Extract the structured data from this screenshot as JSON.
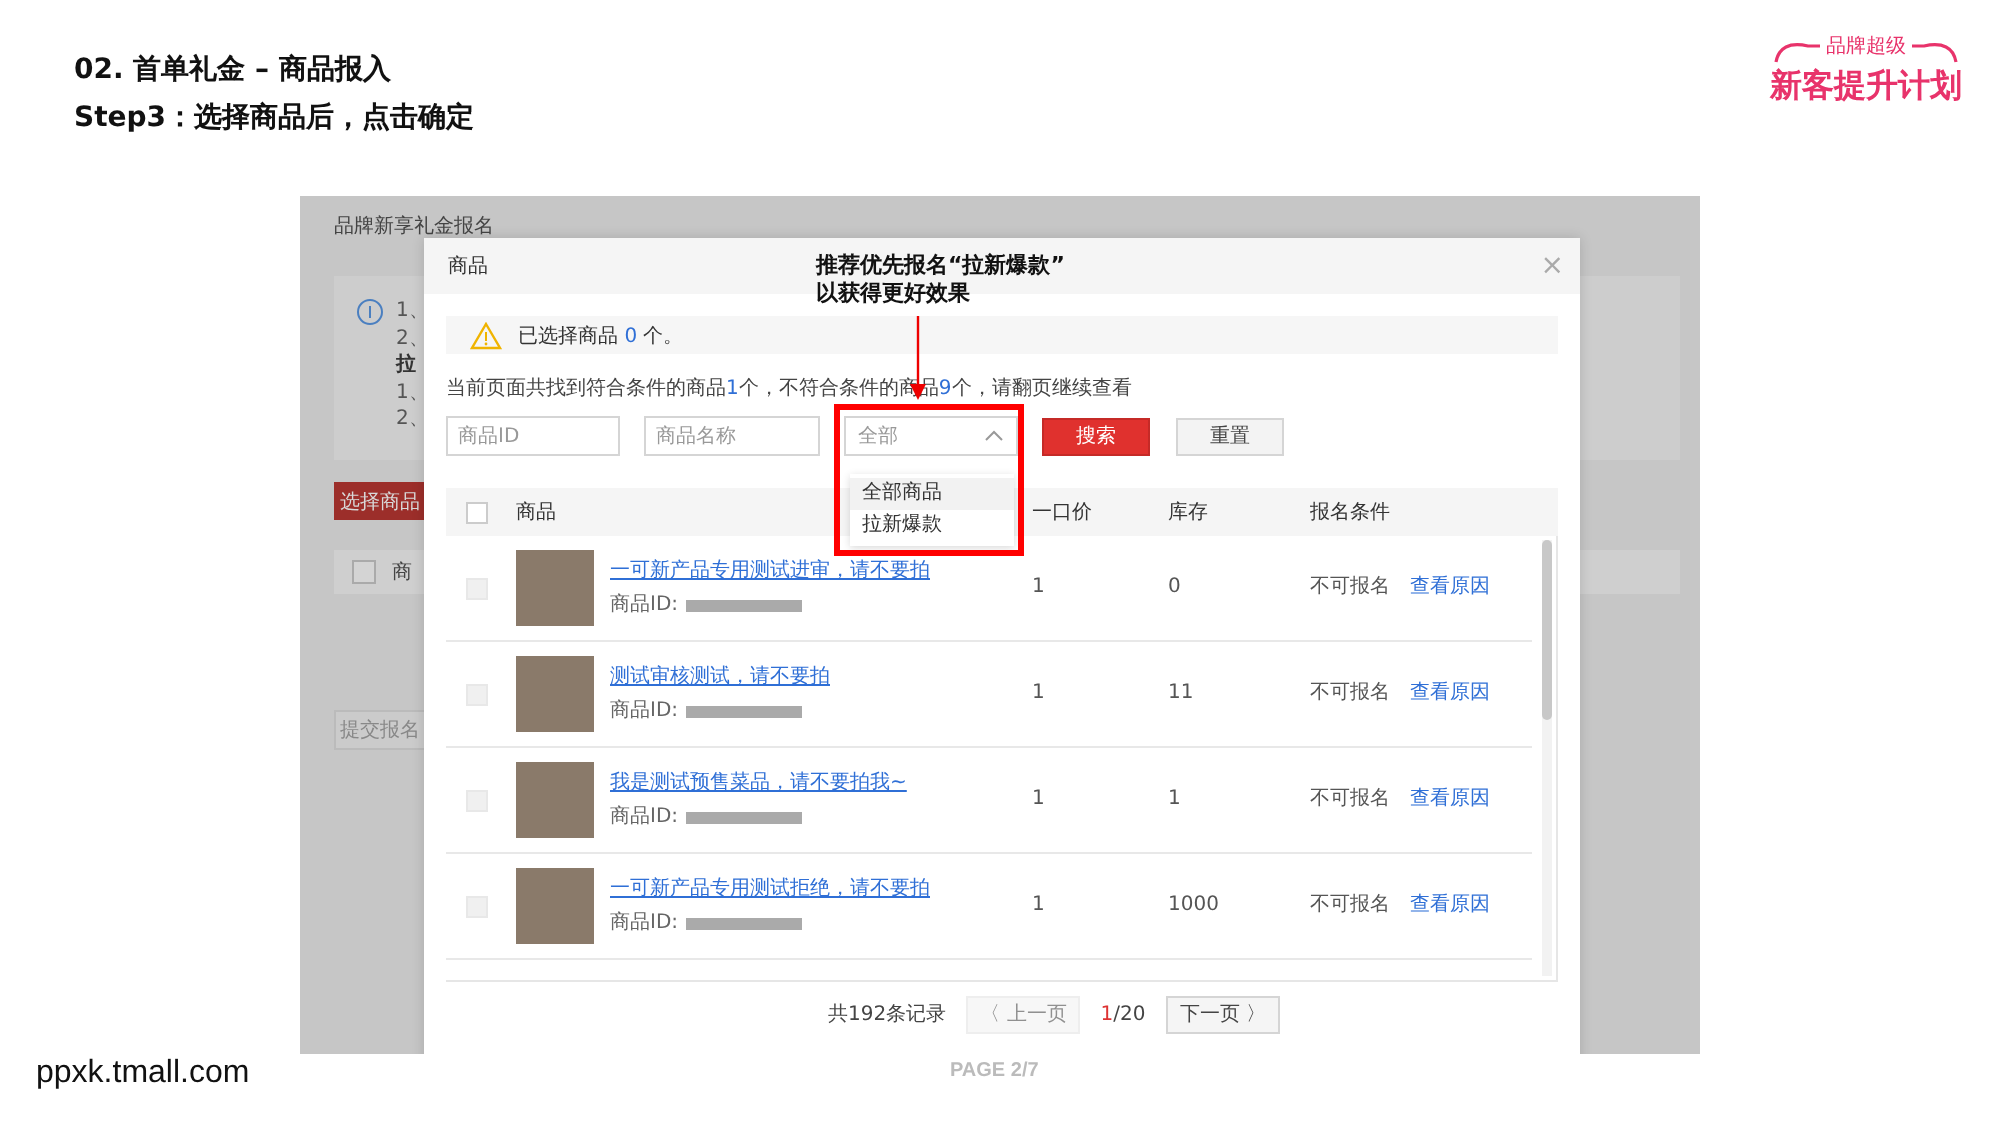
{
  "slide": {
    "heading": "02. 首单礼金 – 商品报入",
    "step": "Step3：选择商品后，点击确定",
    "logo": {
      "tag": "品牌超级",
      "title": "新客提升计划"
    },
    "site": "ppxk.tmall.com",
    "page": "PAGE 2/7"
  },
  "backdrop": {
    "title": "品牌新享礼金报名",
    "notes": [
      {
        "text": "1、",
        "kind": "plain"
      },
      {
        "text": "2、",
        "kind": "plain"
      },
      {
        "text": "拉",
        "kind": "bold"
      },
      {
        "text": "1、",
        "kind": "plain"
      },
      {
        "text": "2、",
        "kind": "plain"
      }
    ],
    "select_button": "选择商品",
    "column": "商",
    "header_checked": false,
    "submit_button": "提交报名"
  },
  "annotation": {
    "lines": [
      "推荐优先报名“拉新爆款”",
      "以获得更好效果"
    ]
  },
  "modal": {
    "title": "商品",
    "close": "×",
    "alert": {
      "prefix": "已选择商品 ",
      "count": "0",
      "suffix": " 个。"
    },
    "info": [
      {
        "text": "当前页面共找到符合条件的商品",
        "highlight": false
      },
      {
        "text": "1",
        "highlight": true
      },
      {
        "text": "个，不符合条件的商品",
        "highlight": false
      },
      {
        "text": "9",
        "highlight": true
      },
      {
        "text": "个，请翻页继续查看",
        "highlight": false
      }
    ],
    "filters": {
      "id_placeholder": "商品ID",
      "name_placeholder": "商品名称",
      "select_value": "全部",
      "expanded": true,
      "options": [
        {
          "label": "全部商品",
          "selected": true
        },
        {
          "label": "拉新爆款",
          "selected": false
        }
      ],
      "search": "搜索",
      "reset": "重置"
    },
    "columns": [
      "商品",
      "一口价",
      "库存",
      "报名条件"
    ],
    "header_checked": false,
    "rows": [
      {
        "title": "一可新产品专用测试进审，请不要拍",
        "id_label": "商品ID:",
        "price": "1",
        "stock": "0",
        "status": "不可报名",
        "action": "查看原因",
        "disabled": true
      },
      {
        "title": "测试审核测试，请不要拍",
        "id_label": "商品ID:",
        "price": "1",
        "stock": "11",
        "status": "不可报名",
        "action": "查看原因",
        "disabled": true
      },
      {
        "title": "我是测试预售菜品，请不要拍我~",
        "id_label": "商品ID:",
        "price": "1",
        "stock": "1",
        "status": "不可报名",
        "action": "查看原因",
        "disabled": true
      },
      {
        "title": "一可新产品专用测试拒绝，请不要拍",
        "id_label": "商品ID:",
        "price": "1",
        "stock": "1000",
        "status": "不可报名",
        "action": "查看原因",
        "disabled": true
      }
    ],
    "pagination": {
      "total": "共192条记录",
      "prev": {
        "label": "〈 上一页",
        "disabled": true
      },
      "current": "1",
      "pages": "/20",
      "next": {
        "label": "下一页 〉",
        "disabled": false
      }
    }
  }
}
